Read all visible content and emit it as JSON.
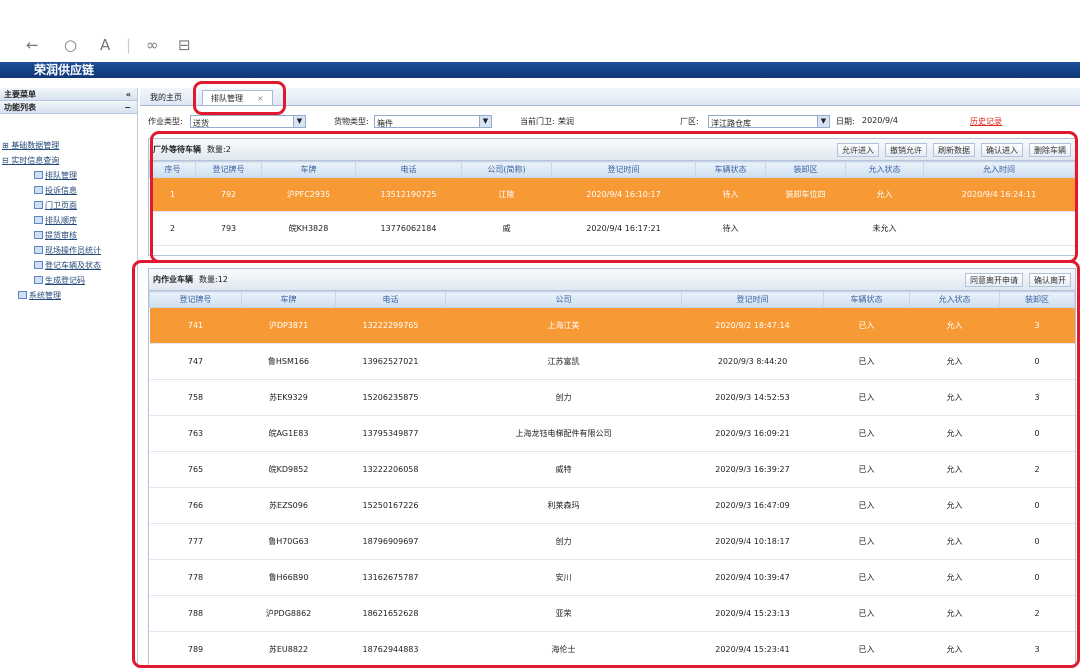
{
  "colors": {
    "accent": "#1d4f9a",
    "highlight": "#f79a35",
    "annotation": "#e0192f"
  },
  "toolbar": {
    "back": "←",
    "refresh": "○",
    "font": "A",
    "link": "∞",
    "layout": "⊟"
  },
  "app": {
    "title": "荣润供应链"
  },
  "sidebar": {
    "menu": "主要菜单",
    "collapse": "«",
    "func": "功能列表",
    "func_toggle": "−",
    "items": [
      {
        "label": "基础数据管理",
        "prefix": "⊞"
      },
      {
        "label": "实时信息查询",
        "prefix": "⊟"
      },
      {
        "label": "排队管理"
      },
      {
        "label": "投诉信息"
      },
      {
        "label": "门卫页面"
      },
      {
        "label": "排队顺序"
      },
      {
        "label": "提货审核"
      },
      {
        "label": "现场操作员统计"
      },
      {
        "label": "登记车辆及状态"
      },
      {
        "label": "生成登记码"
      },
      {
        "label": "系统管理"
      }
    ]
  },
  "tabs": [
    {
      "label": "我的主页"
    },
    {
      "label": "排队管理",
      "close": "×"
    }
  ],
  "filter": {
    "work_type_label": "作业类型:",
    "work_type": "送货",
    "goods_type_label": "货物类型:",
    "goods_type": "箱件",
    "gate_label": "当前门卫:",
    "gate": "荣润",
    "area_label": "厂区:",
    "area": "洋江路仓库",
    "date_label": "日期:",
    "date": "2020/9/4",
    "history": "历史记录"
  },
  "outside": {
    "title": "厂外等待车辆",
    "count": "数量:2",
    "buttons": [
      "允许进入",
      "撤销允许",
      "刷新数据",
      "确认进入",
      "删除车辆"
    ],
    "headers": [
      "序号",
      "登记牌号",
      "车牌",
      "电话",
      "公司(简称)",
      "登记时间",
      "车辆状态",
      "装卸区",
      "允入状态",
      "允入时间"
    ],
    "rows": [
      [
        "1",
        "792",
        "沪PFC2935",
        "13512190725",
        "江陵",
        "2020/9/4 16:10:17",
        "待入",
        "装卸车位四",
        "允入",
        "2020/9/4 16:24:11"
      ],
      [
        "2",
        "793",
        "皖KH3828",
        "13776062184",
        "威",
        "2020/9/4 16:17:21",
        "待入",
        "",
        "未允入",
        ""
      ]
    ]
  },
  "inside": {
    "title": "内作业车辆",
    "count": "数量:12",
    "buttons": [
      "同意离开申请",
      "确认离开"
    ],
    "headers": [
      "登记牌号",
      "车牌",
      "电话",
      "公司",
      "登记时间",
      "车辆状态",
      "允入状态",
      "装卸区"
    ],
    "rows": [
      [
        "741",
        "沪DP3871",
        "13222299765",
        "上海江美",
        "2020/9/2 18:47:14",
        "已入",
        "允入",
        "3"
      ],
      [
        "747",
        "鲁HSM166",
        "13962527021",
        "江苏富凯",
        "2020/9/3 8:44:20",
        "已入",
        "允入",
        "0"
      ],
      [
        "758",
        "苏EK9329",
        "15206235875",
        "创力",
        "2020/9/3 14:52:53",
        "已入",
        "允入",
        "3"
      ],
      [
        "763",
        "皖AG1E83",
        "13795349877",
        "上海龙钰电梯配件有限公司",
        "2020/9/3 16:09:21",
        "已入",
        "允入",
        "0"
      ],
      [
        "765",
        "皖KD9852",
        "13222206058",
        "威特",
        "2020/9/3 16:39:27",
        "已入",
        "允入",
        "2"
      ],
      [
        "766",
        "苏EZS096",
        "15250167226",
        "利莱森玛",
        "2020/9/3 16:47:09",
        "已入",
        "允入",
        "0"
      ],
      [
        "777",
        "鲁H70G63",
        "18796909697",
        "创力",
        "2020/9/4 10:18:17",
        "已入",
        "允入",
        "0"
      ],
      [
        "778",
        "鲁H66B90",
        "13162675787",
        "安川",
        "2020/9/4 10:39:47",
        "已入",
        "允入",
        "0"
      ],
      [
        "788",
        "沪PDG8862",
        "18621652628",
        "亚荣",
        "2020/9/4 15:23:13",
        "已入",
        "允入",
        "2"
      ],
      [
        "789",
        "苏EU8822",
        "18762944883",
        "海伦士",
        "2020/9/4 15:23:41",
        "已入",
        "允入",
        "3"
      ]
    ]
  }
}
